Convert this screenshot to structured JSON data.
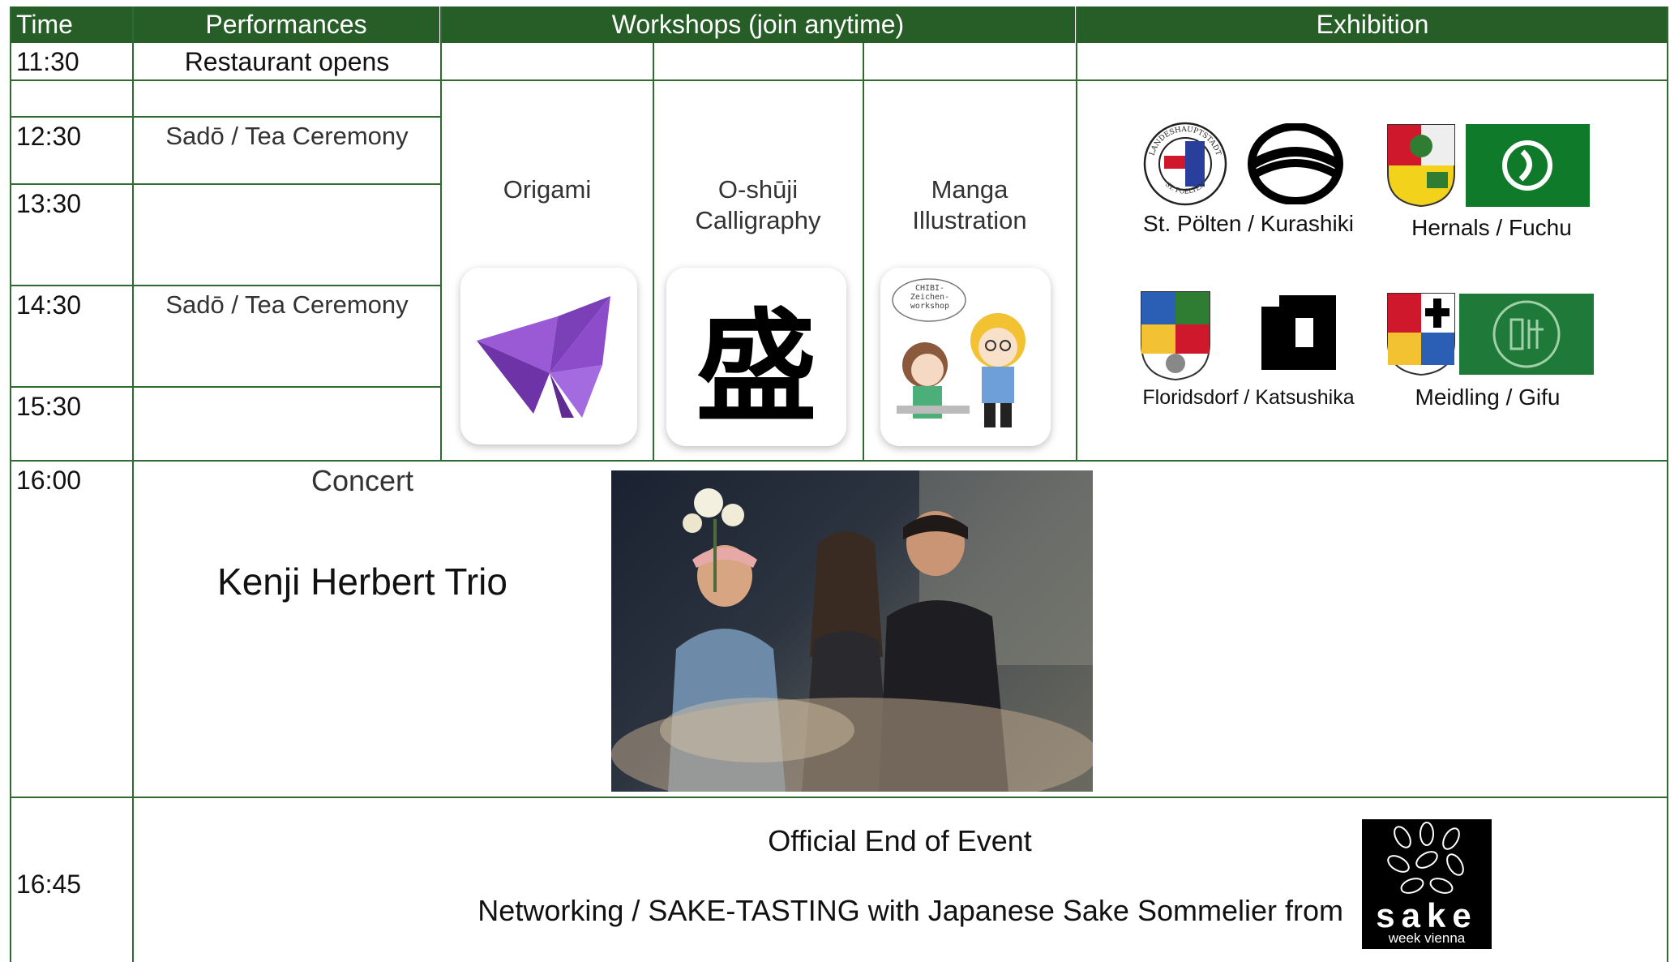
{
  "headers": {
    "time": "Time",
    "performances": "Performances",
    "workshops": "Workshops (join anytime)",
    "exhibition": "Exhibition"
  },
  "times": {
    "t1130": "11:30",
    "t1230": "12:30",
    "t1330": "13:30",
    "t1430": "14:30",
    "t1530": "15:30",
    "t1600": "16:00",
    "t1645": "16:45"
  },
  "performances": {
    "restaurant": "Restaurant opens",
    "tea1": "Sadō / Tea Ceremony",
    "tea2": "Sadō / Tea Ceremony"
  },
  "workshops": {
    "origami": "Origami",
    "calligraphy_1": "O-shūji",
    "calligraphy_2": "Calligraphy",
    "manga_1": "Manga",
    "manga_2": "Illustration",
    "calligraphy_glyph": "盛",
    "manga_note_1": "CHIBI-",
    "manga_note_2": "Zeichen-",
    "manga_note_3": "workshop"
  },
  "exhibition": {
    "pair1": "St. Pölten / Kurashiki",
    "pair2": "Hernals / Fuchu",
    "pair3": "Floridsdorf / Katsushika",
    "pair4": "Meidling / Gifu",
    "seal_top": "LANDESHAUPTSTADT",
    "seal_bottom": "ST. POELTEN"
  },
  "concert": {
    "label": "Concert",
    "artist": "Kenji Herbert Trio"
  },
  "ending": {
    "official_end": "Official End of Event",
    "networking": "Networking / SAKE-TASTING with Japanese Sake Sommelier from",
    "sponsor_main": "sake",
    "sponsor_sub": "week vienna"
  },
  "colors": {
    "header_bg": "#275e27",
    "grid": "#2f6b2f",
    "gifu_green": "#1f7a3a",
    "fuchu_green": "#0f7a2a",
    "origami_purple": "#8a4bc8"
  }
}
